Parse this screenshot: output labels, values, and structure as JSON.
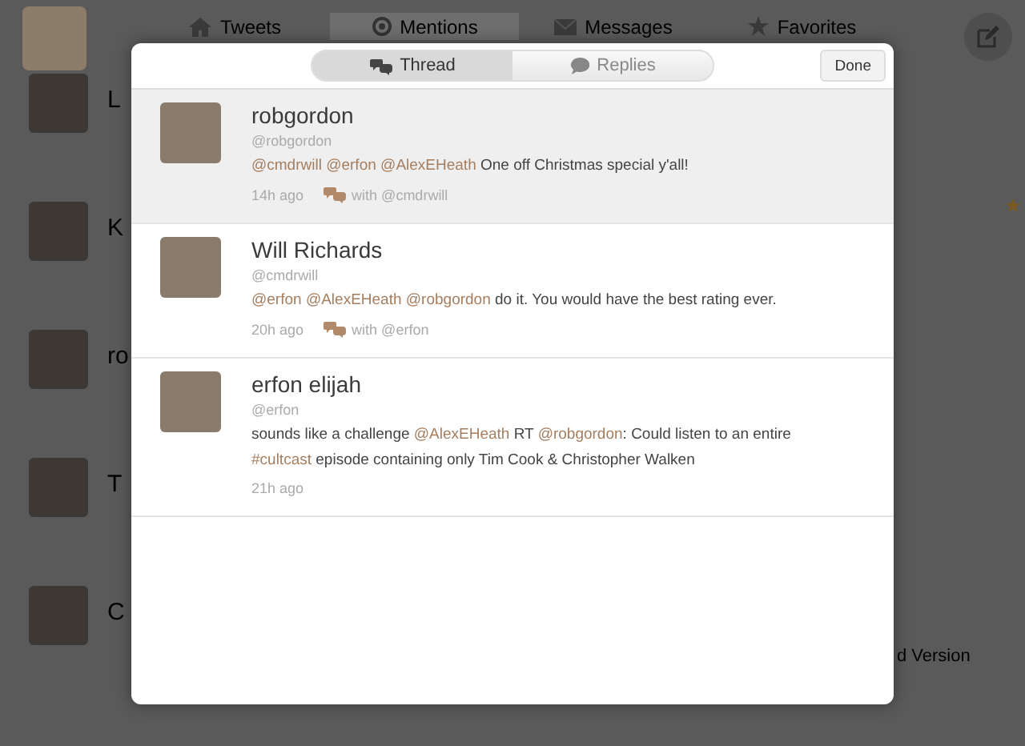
{
  "background": {
    "tabs": [
      {
        "label": "Tweets",
        "selected": false
      },
      {
        "label": "Mentions",
        "selected": true
      },
      {
        "label": "Messages",
        "selected": false
      },
      {
        "label": "Favorites",
        "selected": false
      }
    ],
    "rows": [
      {
        "name": "L",
        "favorite": false
      },
      {
        "name": "K",
        "favorite": true
      },
      {
        "name": "ro",
        "favorite": false
      },
      {
        "name": "T",
        "favorite": false
      },
      {
        "name": "C",
        "favorite": false
      }
    ],
    "trailing_text": "d Version"
  },
  "modal": {
    "tabs": [
      {
        "label": "Thread",
        "selected": true
      },
      {
        "label": "Replies",
        "selected": false
      }
    ],
    "done": "Done",
    "tweets": [
      {
        "name": "robgordon",
        "handle": "@robgordon",
        "selected": true,
        "segments": [
          {
            "kind": "mention",
            "text": "@cmdrwill"
          },
          {
            "kind": "mention",
            "text": "@erfon"
          },
          {
            "kind": "mention",
            "text": "@AlexEHeath"
          },
          {
            "kind": "plain",
            "text": " One off Christmas special y'all!"
          }
        ],
        "time": "14h ago",
        "conversation": "with @cmdrwill"
      },
      {
        "name": "Will Richards",
        "handle": "@cmdrwill",
        "selected": false,
        "segments": [
          {
            "kind": "mention",
            "text": "@erfon"
          },
          {
            "kind": "mention",
            "text": "@AlexEHeath"
          },
          {
            "kind": "mention",
            "text": "@robgordon"
          },
          {
            "kind": "plain",
            "text": " do it. You would have the best rating ever."
          }
        ],
        "time": "20h ago",
        "conversation": "with @erfon"
      },
      {
        "name": "erfon elijah",
        "handle": "@erfon",
        "selected": false,
        "segments": [
          {
            "kind": "plain",
            "text": "sounds like a challenge "
          },
          {
            "kind": "mention",
            "text": "@AlexEHeath"
          },
          {
            "kind": "plain",
            "text": " RT "
          },
          {
            "kind": "mention",
            "text": "@robgordon"
          },
          {
            "kind": "plain",
            "text": ": Could listen to an entire "
          },
          {
            "kind": "hashtag",
            "text": "#cultcast"
          },
          {
            "kind": "plain",
            "text": " episode containing only Tim Cook & Christopher Walken"
          }
        ],
        "time": "21h ago"
      }
    ]
  }
}
